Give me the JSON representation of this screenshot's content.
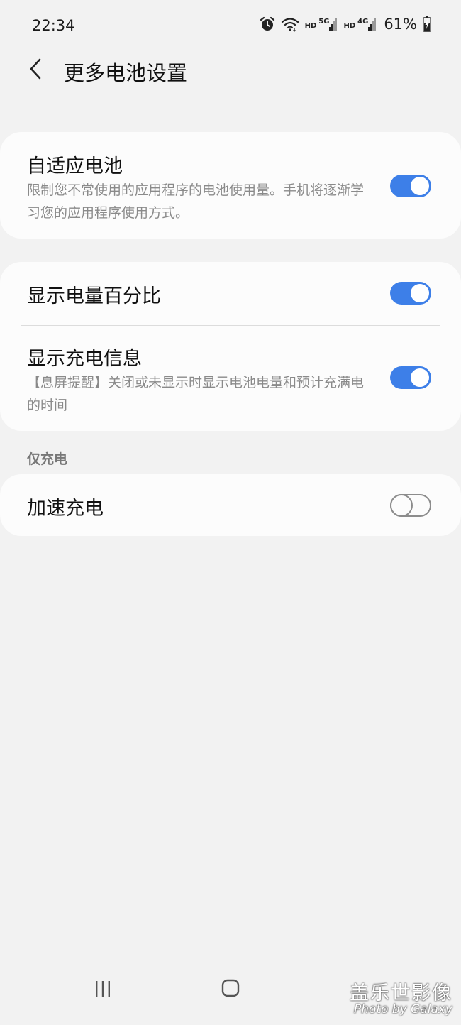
{
  "status_bar": {
    "time": "22:34",
    "net1_hd": "HD",
    "net1_gen": "5G",
    "net2_hd": "HD",
    "net2_gen": "4G",
    "battery_percent": "61%",
    "icons": [
      "alarm-icon",
      "wifi-icon",
      "signal-icon",
      "battery-charging-icon"
    ]
  },
  "header": {
    "title": "更多电池设置"
  },
  "adaptive_card": {
    "title": "自适应电池",
    "description": "限制您不常使用的应用程序的电池使用量。手机将逐渐学习您的应用程序使用方式。",
    "enabled": true
  },
  "display_card": {
    "percent_row": {
      "title": "显示电量百分比",
      "enabled": true
    },
    "charging_info_row": {
      "title": "显示充电信息",
      "description": "【息屏提醒】关闭或未显示时显示电池电量和预计充满电的时间",
      "enabled": true
    }
  },
  "charging_section": {
    "label": "仅充电",
    "fast_charge": {
      "title": "加速充电",
      "enabled": false
    }
  },
  "nav_bar": {
    "icons": [
      "recent-apps-icon",
      "home-icon"
    ]
  },
  "watermark": {
    "main": "盖乐世影像",
    "sub": "Photo by Galaxy"
  },
  "colors": {
    "accent": "#3d7fe8",
    "background": "#f2f2f2",
    "card": "#fcfcfc"
  }
}
